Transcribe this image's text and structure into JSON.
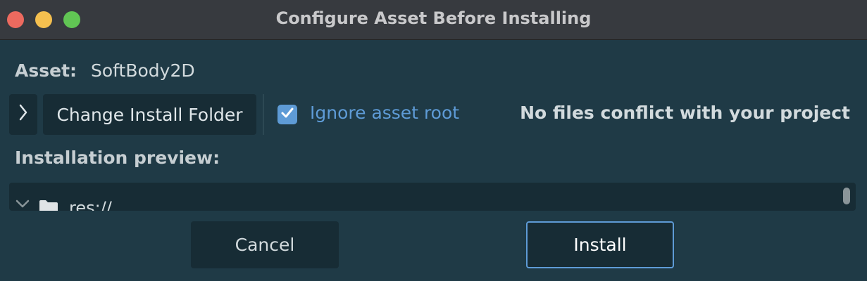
{
  "window": {
    "title": "Configure Asset Before Installing"
  },
  "asset": {
    "label": "Asset:",
    "value": "SoftBody2D"
  },
  "controls": {
    "expand_icon": "chevron-right-icon",
    "change_folder_label": "Change Install Folder",
    "ignore_root_label": "Ignore asset root",
    "ignore_root_checked": true,
    "conflict_status": "No files conflict with your project"
  },
  "preview": {
    "label": "Installation preview:",
    "root_item": "res://"
  },
  "buttons": {
    "cancel": "Cancel",
    "install": "Install"
  },
  "colors": {
    "background": "#1f3a46",
    "accent": "#5e9bd6",
    "button_bg": "#172c35"
  }
}
